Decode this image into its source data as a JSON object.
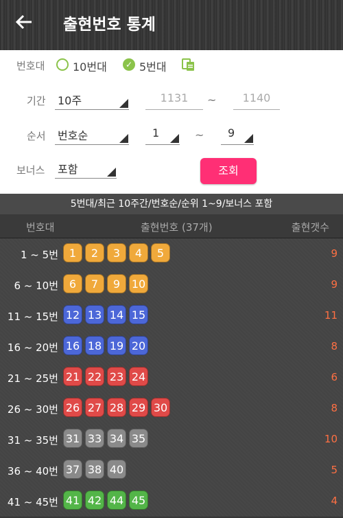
{
  "appbar": {
    "title": "출현번호 통계"
  },
  "filters": {
    "band_label": "번호대",
    "band_options": [
      {
        "label": "10번대",
        "selected": false
      },
      {
        "label": "5번대",
        "selected": true
      }
    ],
    "period_label": "기간",
    "period_value": "10주",
    "period_from_placeholder": "1131",
    "period_to_placeholder": "1140",
    "order_label": "순서",
    "order_value": "번호순",
    "rank_from": "1",
    "rank_to": "9",
    "tilde": "~",
    "bonus_label": "보너스",
    "bonus_value": "포함",
    "search_button": "조회"
  },
  "summary": "5번대/최근 10주간/번호순/순위 1~9/보너스 포함",
  "table": {
    "headers": {
      "band": "번호대",
      "numbers": "출현번호 (37개)",
      "count": "출현갯수"
    },
    "rows": [
      {
        "range": "1 ~ 5번",
        "color": "orange",
        "numbers": [
          "1",
          "2",
          "3",
          "4",
          "5"
        ],
        "count": "9"
      },
      {
        "range": "6 ~ 10번",
        "color": "orange",
        "numbers": [
          "6",
          "7",
          "9",
          "10"
        ],
        "count": "9"
      },
      {
        "range": "11 ~ 15번",
        "color": "blue",
        "numbers": [
          "12",
          "13",
          "14",
          "15"
        ],
        "count": "11"
      },
      {
        "range": "16 ~ 20번",
        "color": "blue",
        "numbers": [
          "16",
          "18",
          "19",
          "20"
        ],
        "count": "8"
      },
      {
        "range": "21 ~ 25번",
        "color": "red",
        "numbers": [
          "21",
          "22",
          "23",
          "24"
        ],
        "count": "6"
      },
      {
        "range": "26 ~ 30번",
        "color": "red",
        "numbers": [
          "26",
          "27",
          "28",
          "29",
          "30"
        ],
        "count": "8"
      },
      {
        "range": "31 ~ 35번",
        "color": "gray",
        "numbers": [
          "31",
          "33",
          "34",
          "35"
        ],
        "count": "10"
      },
      {
        "range": "36 ~ 40번",
        "color": "gray",
        "numbers": [
          "37",
          "38",
          "40"
        ],
        "count": "5"
      },
      {
        "range": "41 ~ 45번",
        "color": "green",
        "numbers": [
          "41",
          "42",
          "44",
          "45"
        ],
        "count": "4"
      }
    ]
  },
  "colors": {
    "orange": "#f0a93b",
    "blue": "#4c67d8",
    "red": "#e04a48",
    "gray": "#8a8a8a",
    "green": "#53b548",
    "accent": "#ff2f75",
    "check": "#8bc34a",
    "count": "#ff7043"
  }
}
